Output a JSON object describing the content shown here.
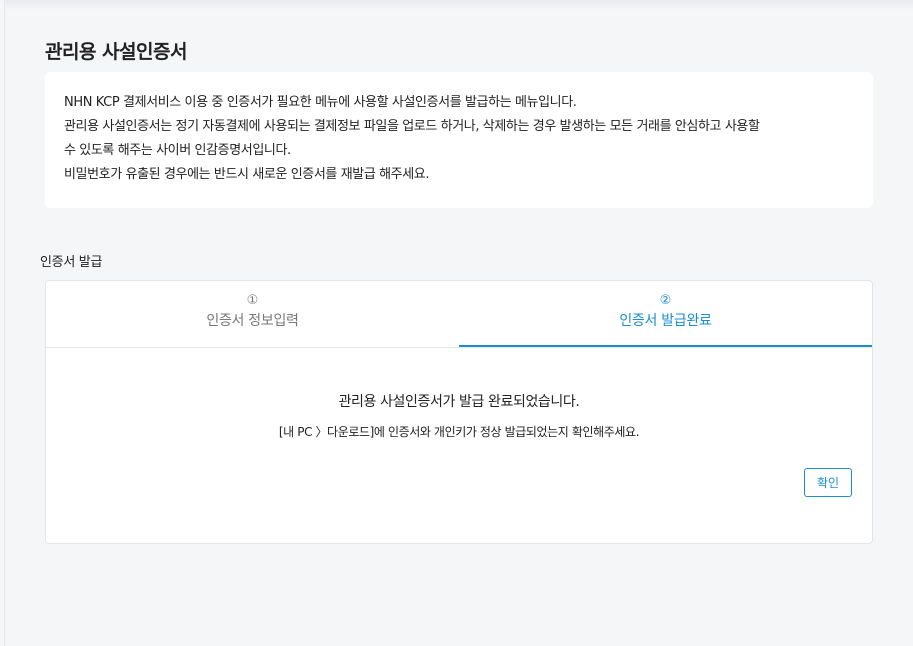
{
  "page": {
    "title": "관리용 사설인증서"
  },
  "info": {
    "lines": [
      "NHN KCP 결제서비스 이용 중 인증서가 필요한 메뉴에 사용할 사설인증서를 발급하는 메뉴입니다.",
      "관리용 사설인증서는 정기 자동결제에 사용되는 결제정보 파일을 업로드 하거나, 삭제하는 경우 발생하는 모든 거래를 안심하고 사용할",
      "수 있도록 해주는 사이버 인감증명서입니다.",
      "비밀번호가 유출된 경우에는 반드시 새로운 인증서를 재발급 해주세요."
    ]
  },
  "section": {
    "label": "인증서 발급"
  },
  "steps": [
    {
      "number": "①",
      "label": "인증서 정보입력",
      "active": false
    },
    {
      "number": "②",
      "label": "인증서 발급완료",
      "active": true
    }
  ],
  "result": {
    "message": "관리용 사설인증서가 발급 완료되었습니다.",
    "detail": "[내 PC 〉다운로드]에 인증서와 개인키가 정상 발급되었는지 확인해주세요.",
    "confirm_label": "확인"
  },
  "colors": {
    "accent": "#1a8fd0",
    "background": "#f5f6f8"
  }
}
